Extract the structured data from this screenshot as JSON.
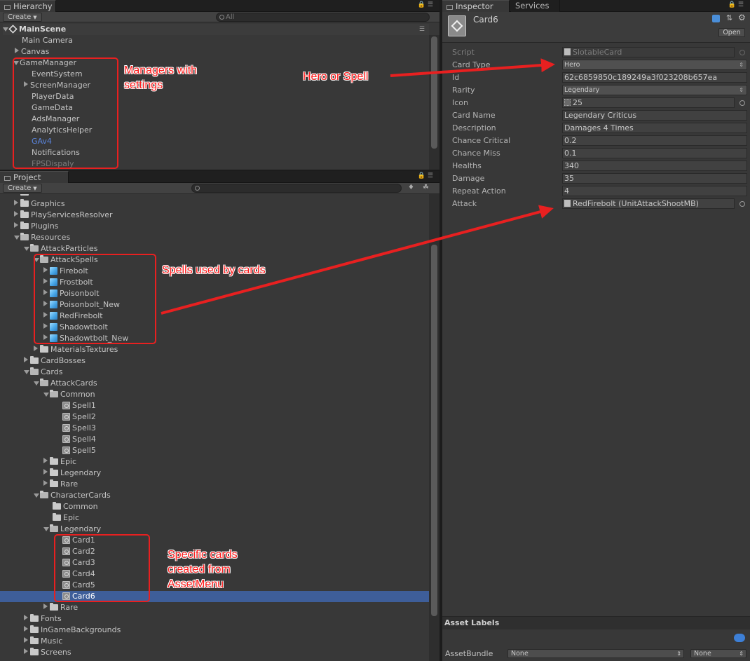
{
  "hierarchy": {
    "tab": "Hierarchy",
    "create": "Create",
    "search_placeholder": "All",
    "scene": "MainScene",
    "items": [
      "Main Camera",
      "Canvas",
      "GameManager",
      "EventSystem",
      "ScreenManager",
      "PlayerData",
      "GameData",
      "AdsManager",
      "AnalyticsHelper",
      "GAv4",
      "Notifications",
      "FPSDispaly"
    ]
  },
  "project": {
    "tab": "Project",
    "create": "Create",
    "items": [
      "Graphics",
      "PlayServicesResolver",
      "Plugins",
      "Resources",
      "AttackParticles",
      "AttackSpells",
      "Firebolt",
      "Frostbolt",
      "Poisonbolt",
      "Poisonbolt_New",
      "RedFirebolt",
      "Shadowtbolt",
      "Shadowtbolt_New",
      "MaterialsTextures",
      "CardBosses",
      "Cards",
      "AttackCards",
      "Common",
      "Spell1",
      "Spell2",
      "Spell3",
      "Spell4",
      "Spell5",
      "Epic",
      "Legendary",
      "Rare",
      "CharacterCards",
      "Common",
      "Epic",
      "Legendary",
      "Card1",
      "Card2",
      "Card3",
      "Card4",
      "Card5",
      "Card6",
      "Rare",
      "Fonts",
      "InGameBackgrounds",
      "Music",
      "Screens"
    ]
  },
  "inspector": {
    "tabs": [
      "Inspector",
      "Services"
    ],
    "object_name": "Card6",
    "open_label": "Open",
    "fields": [
      {
        "label": "Script",
        "value": "SlotableCard"
      },
      {
        "label": "Card Type",
        "value": "Hero"
      },
      {
        "label": "Id",
        "value": "62c6859850c189249a3f023208b657ea"
      },
      {
        "label": "Rarity",
        "value": "Legendary"
      },
      {
        "label": "Icon",
        "value": "25"
      },
      {
        "label": "Card Name",
        "value": "Legendary Criticus"
      },
      {
        "label": "Description",
        "value": "Damages 4 Times"
      },
      {
        "label": "Chance Critical",
        "value": "0.2"
      },
      {
        "label": "Chance Miss",
        "value": "0.1"
      },
      {
        "label": "Healths",
        "value": "340"
      },
      {
        "label": "Damage",
        "value": "35"
      },
      {
        "label": "Repeat Action",
        "value": "4"
      },
      {
        "label": "Attack",
        "value": "RedFirebolt (UnitAttackShootMB)"
      }
    ],
    "asset_labels": "Asset Labels",
    "asset_bundle_label": "AssetBundle",
    "asset_bundle_value": "None",
    "asset_variant_value": "None"
  },
  "annotations": {
    "managers": "Managers with\nsettings",
    "hero_or_spell": "Hero or Spell",
    "spells": "Spells used by cards",
    "specific_cards": "Specific cards\ncreated from\nAssetMenu"
  },
  "colors": {
    "annotation": "#e82020",
    "selection": "#3e5e99",
    "link_blue": "#5b86e0"
  }
}
